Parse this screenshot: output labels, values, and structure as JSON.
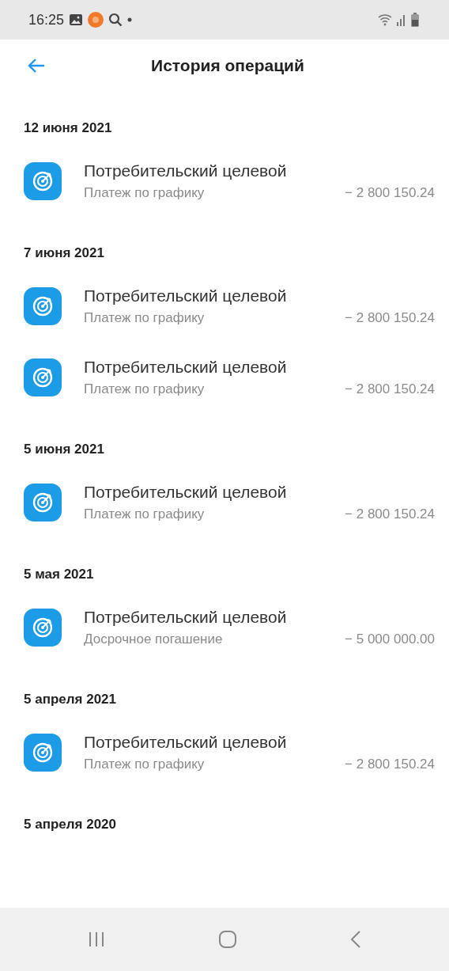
{
  "status_bar": {
    "time": "16:25"
  },
  "header": {
    "title": "История операций"
  },
  "groups": [
    {
      "date": "12 июня 2021",
      "operations": [
        {
          "title": "Потребительский целевой",
          "type": "Платеж по графику",
          "amount": "− 2 800 150.24"
        }
      ]
    },
    {
      "date": "7 июня 2021",
      "operations": [
        {
          "title": "Потребительский целевой",
          "type": "Платеж по графику",
          "amount": "− 2 800 150.24"
        },
        {
          "title": "Потребительский целевой",
          "type": "Платеж по графику",
          "amount": "− 2 800 150.24"
        }
      ]
    },
    {
      "date": "5 июня 2021",
      "operations": [
        {
          "title": "Потребительский целевой",
          "type": "Платеж по графику",
          "amount": "− 2 800 150.24"
        }
      ]
    },
    {
      "date": "5 мая 2021",
      "operations": [
        {
          "title": "Потребительский целевой",
          "type": "Досрочное погашение",
          "amount": "− 5 000 000.00"
        }
      ]
    },
    {
      "date": "5 апреля 2021",
      "operations": [
        {
          "title": "Потребительский целевой",
          "type": "Платеж по графику",
          "amount": "− 2 800 150.24"
        }
      ]
    },
    {
      "date": "5 апреля 2020"
    }
  ]
}
